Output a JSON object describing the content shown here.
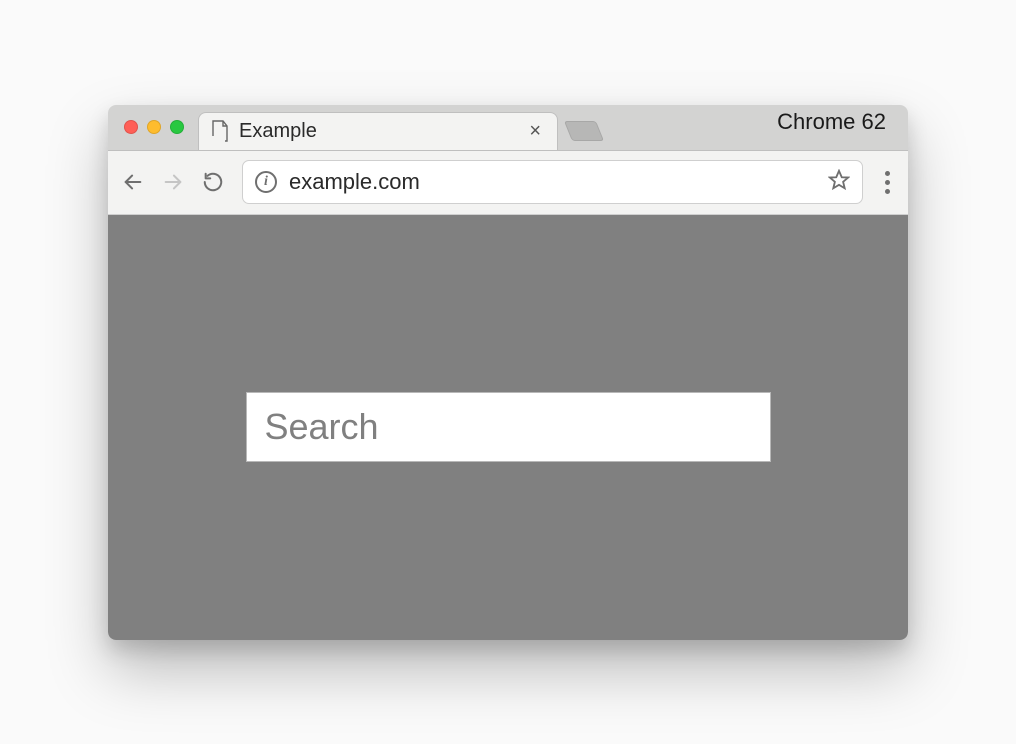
{
  "window": {
    "tab_title": "Example",
    "browser_label": "Chrome 62"
  },
  "toolbar": {
    "url": "example.com"
  },
  "page": {
    "search_placeholder": "Search",
    "search_value": ""
  }
}
